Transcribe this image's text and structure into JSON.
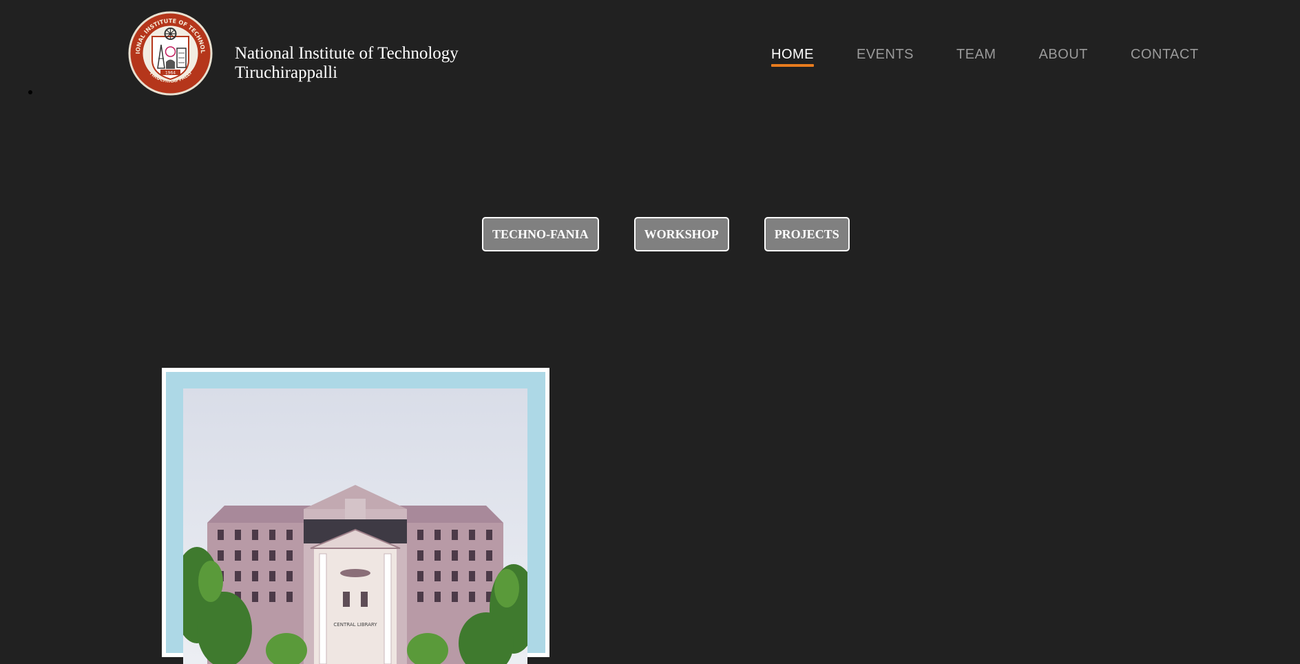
{
  "header": {
    "institute_line1": "National Institute of Technology",
    "institute_line2": "Tiruchirappalli",
    "logo": {
      "outer_text": "NATIONAL INSTITUTE OF TECHNOLOGY",
      "bottom_text": "TIRUCHIRAPPALLI",
      "year": "1964",
      "ring_color": "#b5361b"
    }
  },
  "nav": {
    "items": [
      {
        "label": "HOME",
        "active": true
      },
      {
        "label": "EVENTS",
        "active": false
      },
      {
        "label": "TEAM",
        "active": false
      },
      {
        "label": "ABOUT",
        "active": false
      },
      {
        "label": "CONTACT",
        "active": false
      }
    ],
    "active_underline_color": "#e87c1e"
  },
  "tabs": [
    {
      "label": "TECHNO-FANIA"
    },
    {
      "label": "WORKSHOP"
    },
    {
      "label": "PROJECTS"
    }
  ],
  "card": {
    "image_caption": "CENTRAL LIBRARY",
    "frame_color": "#add8e6"
  },
  "theme": {
    "background": "#212121",
    "button_bg": "#808080"
  }
}
